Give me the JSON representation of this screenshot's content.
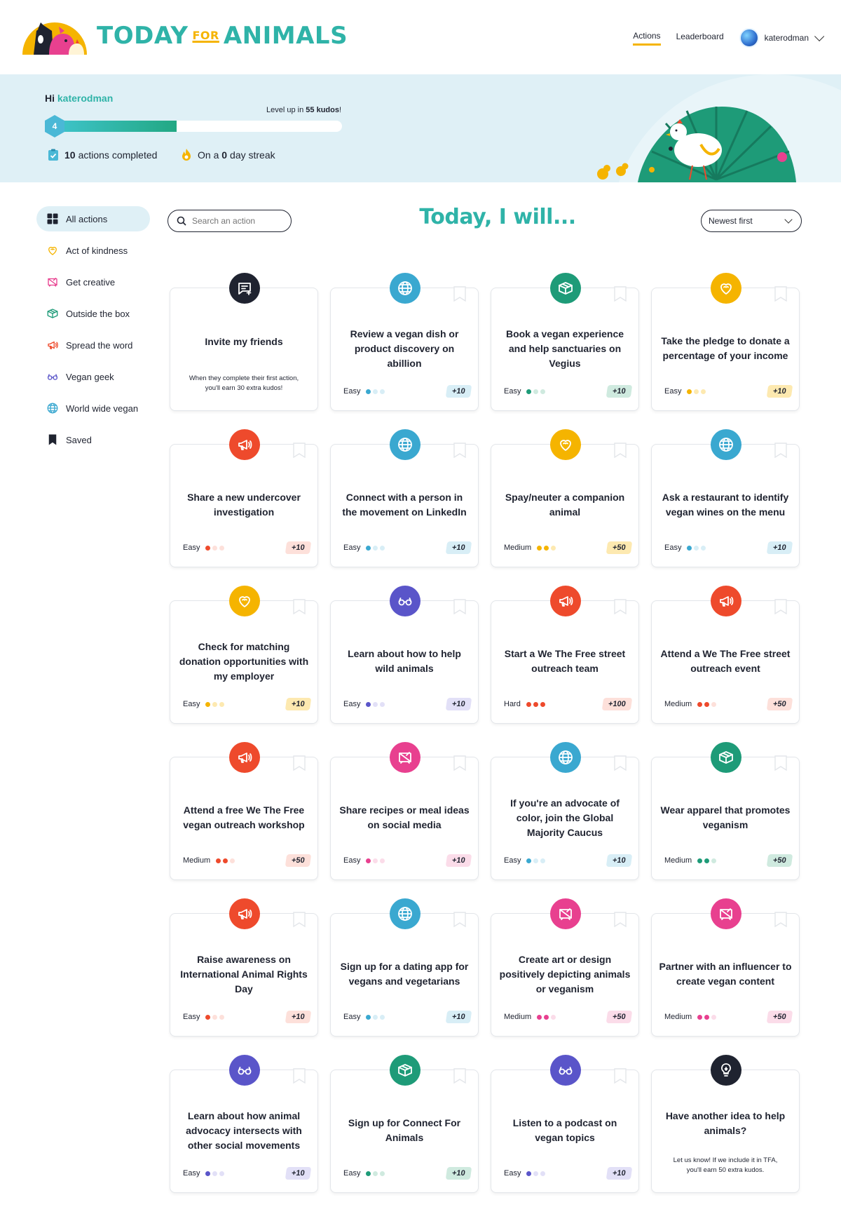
{
  "header": {
    "brand_left": "TODAY",
    "brand_for": "FOR",
    "brand_right": "ANIMALS",
    "nav": [
      {
        "label": "Actions",
        "active": true
      },
      {
        "label": "Leaderboard",
        "active": false
      }
    ],
    "username": "katerodman"
  },
  "banner": {
    "greeting": "Hi",
    "username": "katerodman",
    "level": "4",
    "level_up_prefix": "Level up in",
    "level_up_amount": "55 kudos",
    "level_up_suffix": "!",
    "progress_fraction": 0.44,
    "actions_count": "10",
    "actions_text": "actions completed",
    "streak_prefix": "On a",
    "streak_count": "0",
    "streak_suffix": "day streak"
  },
  "sidebar": {
    "items": [
      {
        "label": "All actions",
        "icon": "grid-icon",
        "active": true
      },
      {
        "label": "Act of kindness",
        "icon": "heart-icon",
        "active": false
      },
      {
        "label": "Get creative",
        "icon": "canvas-icon",
        "active": false
      },
      {
        "label": "Outside the box",
        "icon": "box-icon",
        "active": false
      },
      {
        "label": "Spread the word",
        "icon": "megaphone-icon",
        "active": false
      },
      {
        "label": "Vegan geek",
        "icon": "glasses-icon",
        "active": false
      },
      {
        "label": "World wide vegan",
        "icon": "globe-icon",
        "active": false
      },
      {
        "label": "Saved",
        "icon": "bookmark-icon",
        "active": false
      }
    ]
  },
  "search": {
    "placeholder": "Search an action"
  },
  "main_title": "Today, I will...",
  "sort": {
    "selected": "Newest first"
  },
  "colors": {
    "teal": "#2fb3a8",
    "yellow": "#f5b400",
    "orange_red": "#ee4a2c",
    "blue": "#3aa8d0",
    "green": "#1e9b78",
    "purple": "#5a55c9",
    "pink": "#e8408f",
    "dark": "#1f2330"
  },
  "cards": [
    {
      "title": "Invite my friends",
      "sub": "When they complete their first action, you'll earn 30 extra kudos!",
      "icon": "message-plus-icon",
      "category": "dark",
      "special": true
    },
    {
      "title": "Review a vegan dish or product discovery on abillion",
      "difficulty": "Easy",
      "level": 1,
      "points": "+10",
      "icon": "globe-icon",
      "category": "blue"
    },
    {
      "title": "Book a vegan experience and help sanctuaries on Vegius",
      "difficulty": "Easy",
      "level": 1,
      "points": "+10",
      "icon": "box-icon",
      "category": "green"
    },
    {
      "title": "Take the pledge to donate a percentage of your income",
      "difficulty": "Easy",
      "level": 1,
      "points": "+10",
      "icon": "heart-icon",
      "category": "yellow"
    },
    {
      "title": "Share a new undercover investigation",
      "difficulty": "Easy",
      "level": 1,
      "points": "+10",
      "icon": "megaphone-icon",
      "category": "orange_red"
    },
    {
      "title": "Connect with a person in the movement on LinkedIn",
      "difficulty": "Easy",
      "level": 1,
      "points": "+10",
      "icon": "globe-icon",
      "category": "blue"
    },
    {
      "title": "Spay/neuter a companion animal",
      "difficulty": "Medium",
      "level": 2,
      "points": "+50",
      "icon": "heart-icon",
      "category": "yellow"
    },
    {
      "title": "Ask a restaurant to identify vegan wines on the menu",
      "difficulty": "Easy",
      "level": 1,
      "points": "+10",
      "icon": "globe-icon",
      "category": "blue"
    },
    {
      "title": "Check for matching donation opportunities with my employer",
      "difficulty": "Easy",
      "level": 1,
      "points": "+10",
      "icon": "heart-icon",
      "category": "yellow"
    },
    {
      "title": "Learn about how to help wild animals",
      "difficulty": "Easy",
      "level": 1,
      "points": "+10",
      "icon": "glasses-icon",
      "category": "purple"
    },
    {
      "title": "Start a We The Free street outreach team",
      "difficulty": "Hard",
      "level": 3,
      "points": "+100",
      "icon": "megaphone-icon",
      "category": "orange_red"
    },
    {
      "title": "Attend a We The Free street outreach event",
      "difficulty": "Medium",
      "level": 2,
      "points": "+50",
      "icon": "megaphone-icon",
      "category": "orange_red"
    },
    {
      "title": "Attend a free We The Free vegan outreach workshop",
      "difficulty": "Medium",
      "level": 2,
      "points": "+50",
      "icon": "megaphone-icon",
      "category": "orange_red"
    },
    {
      "title": "Share recipes or meal ideas on social media",
      "difficulty": "Easy",
      "level": 1,
      "points": "+10",
      "icon": "canvas-icon",
      "category": "pink"
    },
    {
      "title": "If you're an advocate of color, join the Global Majority Caucus",
      "difficulty": "Easy",
      "level": 1,
      "points": "+10",
      "icon": "globe-icon",
      "category": "blue"
    },
    {
      "title": "Wear apparel that promotes veganism",
      "difficulty": "Medium",
      "level": 2,
      "points": "+50",
      "icon": "box-icon",
      "category": "green"
    },
    {
      "title": "Raise awareness on International Animal Rights Day",
      "difficulty": "Easy",
      "level": 1,
      "points": "+10",
      "icon": "megaphone-icon",
      "category": "orange_red"
    },
    {
      "title": "Sign up for a dating app for vegans and vegetarians",
      "difficulty": "Easy",
      "level": 1,
      "points": "+10",
      "icon": "globe-icon",
      "category": "blue"
    },
    {
      "title": "Create art or design positively depicting animals or veganism",
      "difficulty": "Medium",
      "level": 2,
      "points": "+50",
      "icon": "canvas-icon",
      "category": "pink"
    },
    {
      "title": "Partner with an influencer to create vegan content",
      "difficulty": "Medium",
      "level": 2,
      "points": "+50",
      "icon": "canvas-icon",
      "category": "pink"
    },
    {
      "title": "Learn about how animal advocacy intersects with other social movements",
      "difficulty": "Easy",
      "level": 1,
      "points": "+10",
      "icon": "glasses-icon",
      "category": "purple"
    },
    {
      "title": "Sign up for Connect For Animals",
      "difficulty": "Easy",
      "level": 1,
      "points": "+10",
      "icon": "box-icon",
      "category": "green"
    },
    {
      "title": "Listen to a podcast on vegan topics",
      "difficulty": "Easy",
      "level": 1,
      "points": "+10",
      "icon": "glasses-icon",
      "category": "purple"
    },
    {
      "title": "Have another idea to help animals?",
      "sub": "Let us know! If we include it in TFA, you'll earn 50 extra kudos.",
      "icon": "lightbulb-icon",
      "category": "dark",
      "special": true
    }
  ]
}
